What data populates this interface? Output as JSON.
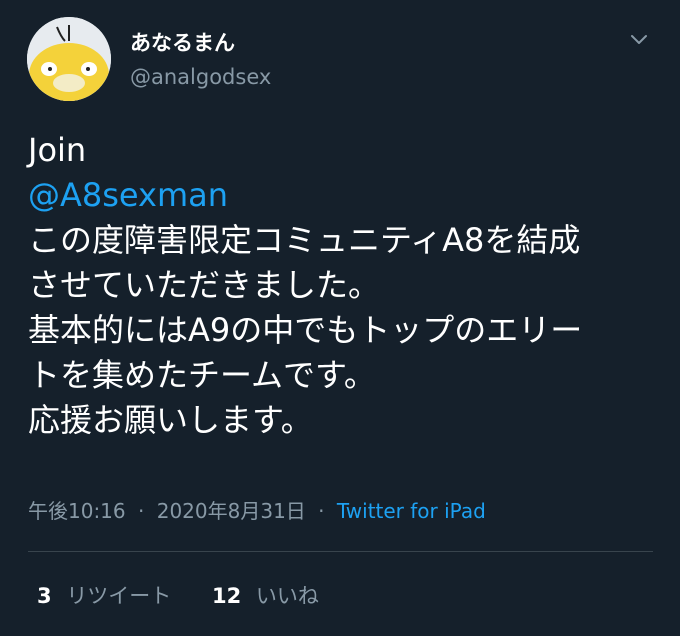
{
  "author": {
    "display_name": "あなるまん",
    "handle": "@analgodsex",
    "avatar_icon": "psyduck-avatar-icon"
  },
  "tweet": {
    "line1": "Join",
    "mention": "@A8sexman",
    "line3": "この度障害限定コミュニティA8を結成",
    "line4": "させていただきました。",
    "line5": "基本的にはA9の中でもトップのエリー",
    "line6": "トを集めたチームです。",
    "line7": "応援お願いします。"
  },
  "meta": {
    "time": "午後10:16",
    "separator": "·",
    "date": "2020年8月31日",
    "source": "Twitter for iPad"
  },
  "stats": {
    "retweets_count": "3",
    "retweets_label": "リツイート",
    "likes_count": "12",
    "likes_label": "いいね"
  },
  "colors": {
    "background": "#15202b",
    "link": "#1da1f2",
    "secondary_text": "#8899a6",
    "divider": "#38444d"
  }
}
